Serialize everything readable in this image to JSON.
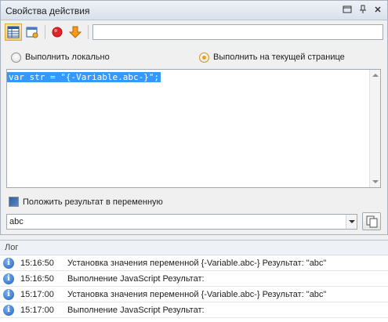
{
  "window": {
    "title": "Свойства действия",
    "controls": [
      "window-list-icon",
      "pin-icon",
      "close-icon"
    ]
  },
  "toolbar": {
    "buttons": [
      {
        "icon": "table-view-icon",
        "active": true
      },
      {
        "icon": "edit-settings-icon",
        "active": false
      },
      {
        "icon": "record-stop-icon",
        "active": false
      },
      {
        "icon": "arrow-down-icon",
        "active": false
      }
    ],
    "input_value": ""
  },
  "mode": {
    "local_label": "Выполнить локально",
    "page_label": "Выполнить на текущей странице",
    "selected": "page"
  },
  "editor": {
    "code": "var str = \"{-Variable.abc-}\";"
  },
  "result": {
    "checkbox_label": "Положить результат в переменную",
    "variable": "abc"
  },
  "log": {
    "title": "Лог",
    "entries": [
      {
        "time": "15:16:50",
        "message": "Установка значения переменной {-Variable.abc-} Результат: \"abc\""
      },
      {
        "time": "15:16:50",
        "message": "Выполнение JavaScript Результат:"
      },
      {
        "time": "15:17:00",
        "message": "Установка значения переменной {-Variable.abc-} Результат: \"abc\""
      },
      {
        "time": "15:17:00",
        "message": "Выполнение JavaScript Результат:"
      }
    ]
  },
  "colors": {
    "selection": "#3399ff",
    "accent": "#e3a21a",
    "info": "#1f5fb4"
  }
}
